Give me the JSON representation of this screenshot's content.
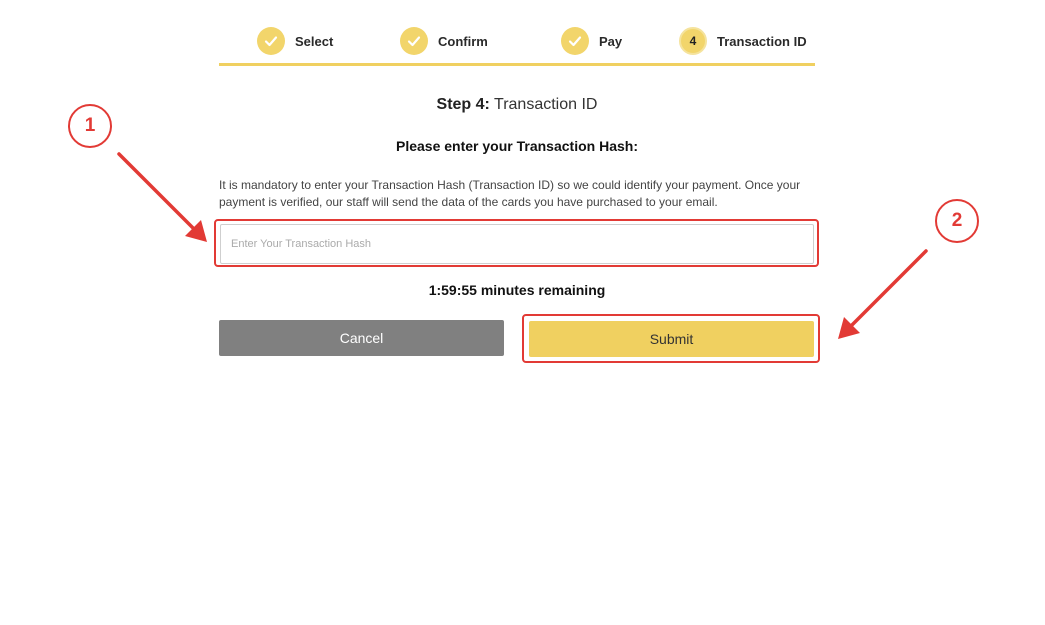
{
  "stepper": {
    "steps": [
      {
        "label": "Select",
        "status": "done"
      },
      {
        "label": "Confirm",
        "status": "done"
      },
      {
        "label": "Pay",
        "status": "done"
      },
      {
        "label": "Transaction ID",
        "status": "current",
        "number": "4"
      }
    ]
  },
  "heading": {
    "prefix": "Step 4:",
    "text": "Transaction ID"
  },
  "subheading": "Please enter your Transaction Hash:",
  "description": "It is mandatory to enter your Transaction Hash (Transaction ID) so we could identify your payment. Once your payment is verified, our staff will send the data of the cards you have purchased to your email.",
  "hash_input": {
    "placeholder": "Enter Your Transaction Hash",
    "value": ""
  },
  "timer": "1:59:55 minutes remaining",
  "buttons": {
    "cancel": "Cancel",
    "submit": "Submit"
  },
  "annotations": {
    "badge_1": "1",
    "badge_2": "2"
  },
  "colors": {
    "accent": "#f0d060",
    "annotation": "#e23a35",
    "cancel": "#808080"
  }
}
